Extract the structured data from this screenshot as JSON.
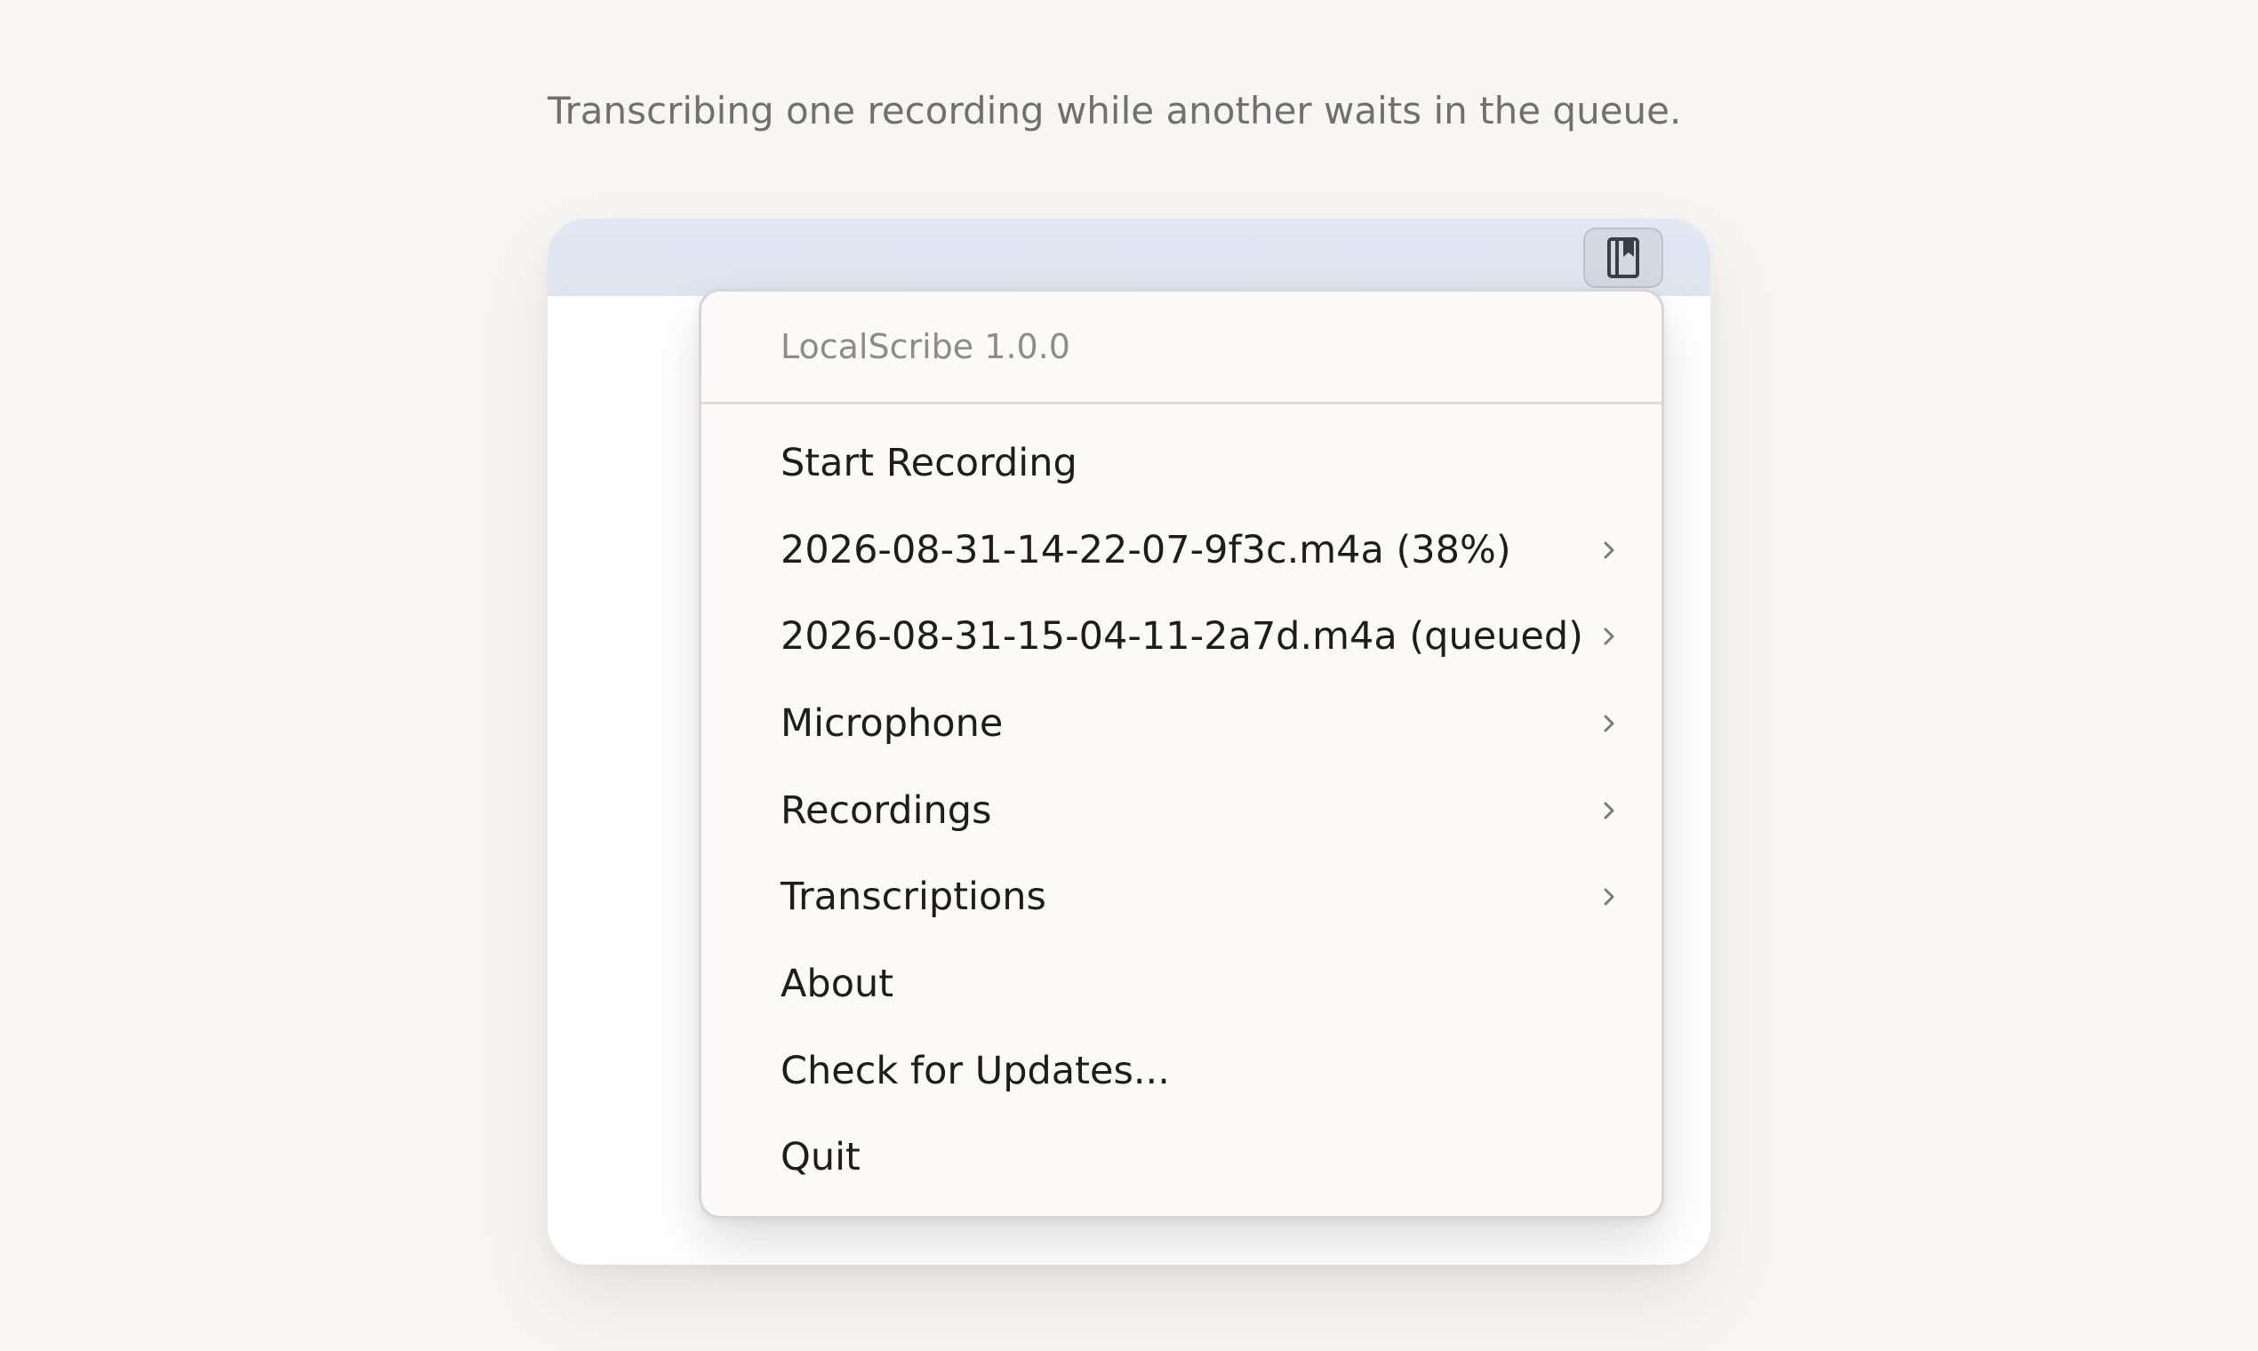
{
  "caption": "Transcribing one recording while another waits in the queue.",
  "menubar": {
    "tray_icon": "notebook-bookmark-icon"
  },
  "menu": {
    "header": "LocalScribe 1.0.0",
    "items": [
      {
        "label": "Start Recording",
        "submenu": false
      },
      {
        "label": "2026-08-31-14-22-07-9f3c.m4a (38%)",
        "submenu": true
      },
      {
        "label": "2026-08-31-15-04-11-2a7d.m4a (queued)",
        "submenu": true
      },
      {
        "label": "Microphone",
        "submenu": true
      },
      {
        "label": "Recordings",
        "submenu": true
      },
      {
        "label": "Transcriptions",
        "submenu": true
      },
      {
        "label": "About",
        "submenu": false
      },
      {
        "label": "Check for Updates...",
        "submenu": false
      },
      {
        "label": "Quit",
        "submenu": false
      }
    ]
  },
  "colors": {
    "page_background": "#f7f6f3",
    "menubar": "#e0e6f1",
    "menu_background": "#fbfaf8"
  }
}
